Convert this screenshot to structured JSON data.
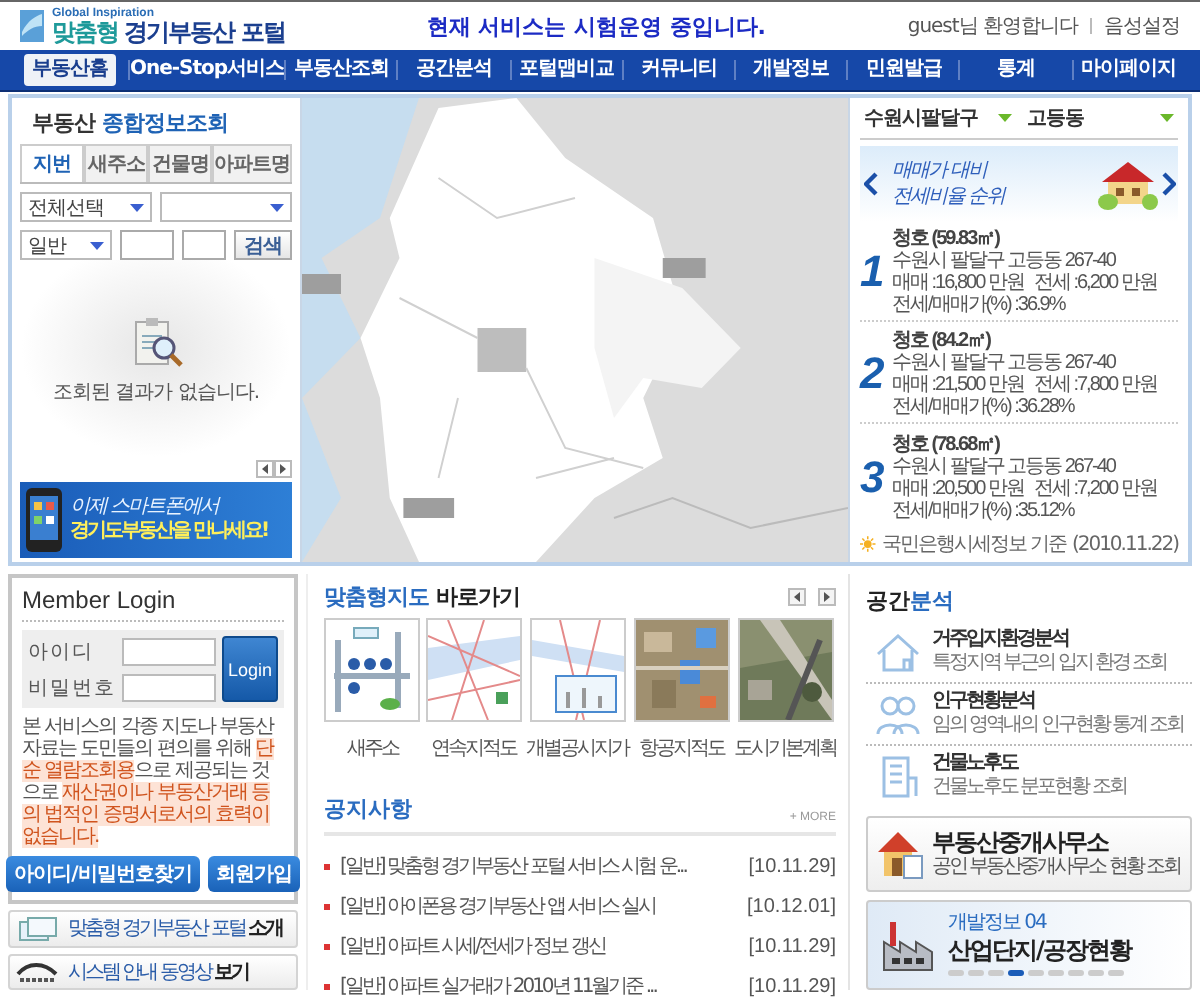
{
  "header": {
    "logo_tagline": "Global Inspiration",
    "logo_name": "**맞춤형** 경기부동산 포털",
    "notice": "현재 서비스는 시험운영 중입니다.",
    "welcome": "guest님 환영합니다",
    "voice_link": "음성설정"
  },
  "nav": [
    {
      "label": "부동산홈",
      "selected": true
    },
    {
      "label": "One-Stop서비스",
      "selected": false
    },
    {
      "label": "부동산조회",
      "selected": false
    },
    {
      "label": "공간분석",
      "selected": false
    },
    {
      "label": "포털맵비교",
      "selected": false
    },
    {
      "label": "커뮤니티",
      "selected": false
    },
    {
      "label": "개발정보",
      "selected": false
    },
    {
      "label": "민원발급",
      "selected": false
    },
    {
      "label": "통계",
      "selected": false
    },
    {
      "label": "마이페이지",
      "selected": false
    }
  ],
  "search_panel": {
    "title": "부동산 **종합정보조회**",
    "tabs": [
      {
        "label": "지번",
        "selected": true
      },
      {
        "label": "새주소",
        "selected": false
      },
      {
        "label": "건물명",
        "selected": false
      },
      {
        "label": "아파트명",
        "selected": false
      }
    ],
    "region_select": "전체선택",
    "type_select": "일반",
    "search_button": "검색",
    "empty_message": "조회된 결과가 없습니다.",
    "banner_line_1": "이제 스마트폰에서",
    "banner_line_2": "경기도부동산을 만나세요!"
  },
  "price_ranking": {
    "district": "수원시팔달구",
    "dong": "고등동",
    "banner_line_1": "매매가 대비",
    "banner_line_2": "전세비율 순위",
    "items": [
      {
        "rank": "1",
        "name": "청호 (59.83㎡)",
        "address": "수원시 팔달구 고등동 267-40",
        "sale": "매매 :16,800 만원",
        "lease": "전세 :6,200 만원",
        "ratio": "전세/매매가(%) :36.9%"
      },
      {
        "rank": "2",
        "name": "청호 (84.2㎡)",
        "address": "수원시 팔달구 고등동 267-40",
        "sale": "매매 :21,500 만원",
        "lease": "전세 :7,800 만원",
        "ratio": "전세/매매가(%) :36.28%"
      },
      {
        "rank": "3",
        "name": "청호 (78.68㎡)",
        "address": "수원시 팔달구 고등동 267-40",
        "sale": "매매 :20,500 만원",
        "lease": "전세 :7,200 만원",
        "ratio": "전세/매매가(%) :35.12%"
      }
    ],
    "source": "국민은행시세정보 기준",
    "date": "(2010.11.22)"
  },
  "login": {
    "title": "Member Login",
    "id_label": "아이디",
    "password_label": "비밀번호",
    "login_button": "Login",
    "notice": "본 서비스의 각종 지도나 부동산자료는 도민들의 편의를 위해 **단순 열람조회용**으로 제공되는 것으로 **재산권이나 부동산거래 등의 법적인 증명서로서의 효력이 없습니다.**",
    "find_button": "아이디/비밀번호찾기",
    "join_button": "회원가입"
  },
  "side_links": [
    "맞춤형 경기부동산 포털 **소개**",
    "시스템 안내 동영상 **보기**"
  ],
  "map_shortcuts": {
    "title": "**맞춤형지도** 바로가기",
    "items": [
      "새주소",
      "연속지적도",
      "개별공시지가",
      "항공지적도",
      "도시기본계획"
    ]
  },
  "notices": {
    "title": "공지사항",
    "more": "+ MORE",
    "items": [
      {
        "text": "[일반] 맞춤형 경기부동산 포털 서비스 시험 운...",
        "date": "[10.11.29]"
      },
      {
        "text": "[일반] 아이폰용 경기부동산 앱 서비스 실시",
        "date": "[10.12.01]"
      },
      {
        "text": "[일반] 아파트 시세/전세가 정보 갱신",
        "date": "[10.11.29]"
      },
      {
        "text": "[일반] 아파트 실거래가 2010년 11월기준 ...",
        "date": "[10.11.29]"
      }
    ]
  },
  "analysis": {
    "title": "공간**분석**",
    "items": [
      {
        "title": "거주입지환경분석",
        "desc": "특정지역 부근의 입지 환경 조회"
      },
      {
        "title": "인구현황분석",
        "desc": "임의 영역내의 인구현황 통계 조회"
      },
      {
        "title": "건물노후도",
        "desc": "건물노후도 분포현황 조회"
      }
    ]
  },
  "broker": {
    "title": "부동산중개사무소",
    "desc": "공인 부동산중개사무소 현황 조회"
  },
  "dev_banner": {
    "label": "개발정보 04",
    "title": "산업단지/공장현황",
    "dots": [
      {
        "selected": false
      },
      {
        "selected": false
      },
      {
        "selected": false
      },
      {
        "selected": true
      },
      {
        "selected": false
      },
      {
        "selected": false
      },
      {
        "selected": false
      },
      {
        "selected": false
      },
      {
        "selected": false
      }
    ]
  }
}
